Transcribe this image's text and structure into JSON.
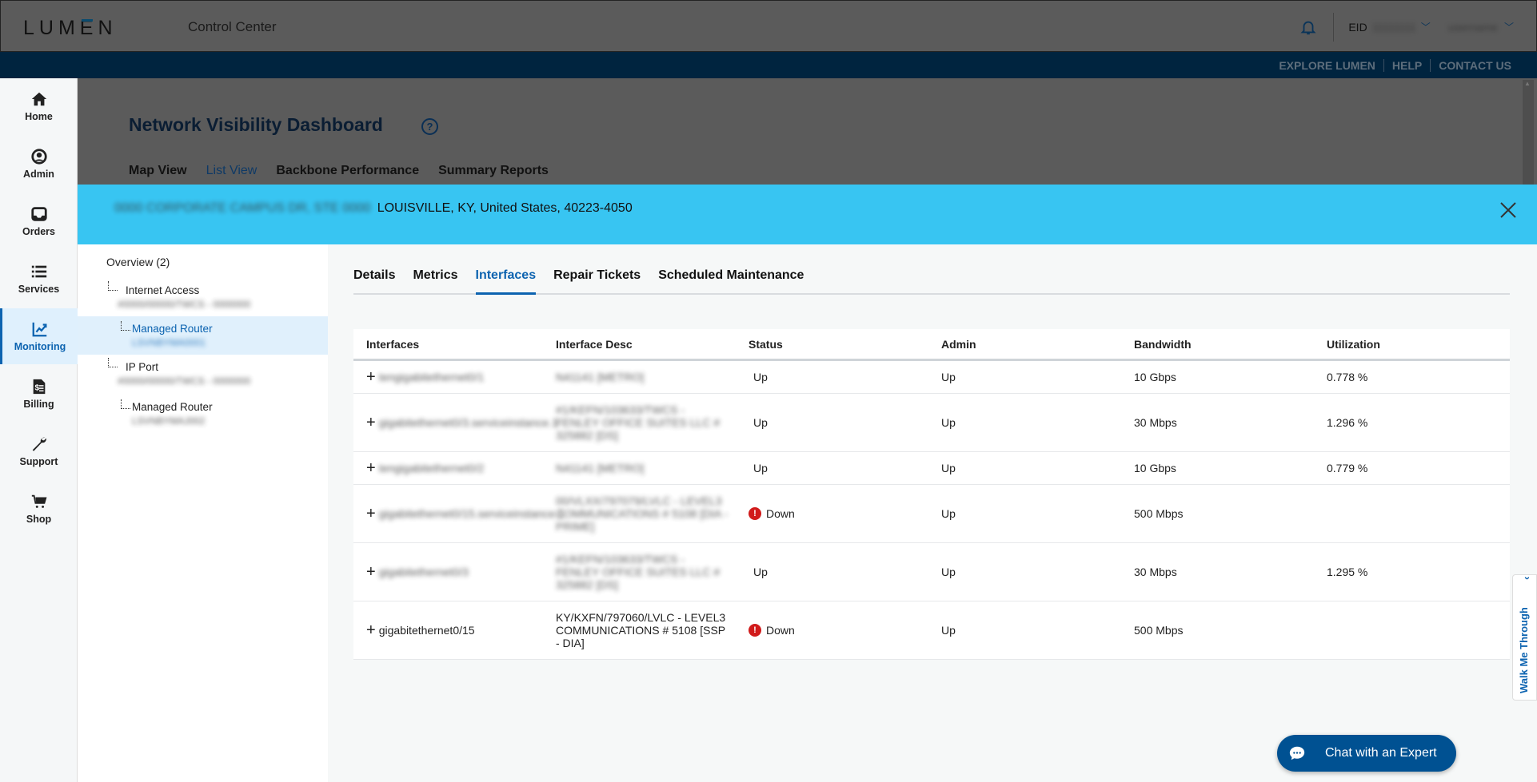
{
  "header": {
    "logo": "LUMEN",
    "app_title": "Control Center",
    "eid_label": "EID",
    "eid_value": "11111111",
    "user_name": "username"
  },
  "navbar": {
    "links": [
      "EXPLORE LUMEN",
      "HELP",
      "CONTACT US"
    ]
  },
  "sidebar": {
    "items": [
      {
        "label": "Home",
        "icon": "home-icon"
      },
      {
        "label": "Admin",
        "icon": "user-circle-icon"
      },
      {
        "label": "Orders",
        "icon": "inbox-icon"
      },
      {
        "label": "Services",
        "icon": "list-icon"
      },
      {
        "label": "Monitoring",
        "icon": "chart-line-icon",
        "active": true
      },
      {
        "label": "Billing",
        "icon": "invoice-icon"
      },
      {
        "label": "Support",
        "icon": "wrench-icon"
      },
      {
        "label": "Shop",
        "icon": "cart-icon"
      }
    ]
  },
  "dashboard": {
    "title": "Network Visibility Dashboard",
    "tabs": [
      "Map View",
      "List View",
      "Backbone Performance",
      "Summary Reports"
    ],
    "selected_tab": "List View"
  },
  "banner": {
    "address_redacted": "0000 CORPORATE CAMPUS DR, STE 0000",
    "address": "LOUISVILLE, KY, United States, 40223-4050"
  },
  "tree": {
    "overview": "Overview (2)",
    "nodes": [
      {
        "label": "Internet Access",
        "sub": "#0000/00000/TWCS - 0000000"
      },
      {
        "label": "Managed Router",
        "sub": "LSVNBYMA0001",
        "selected": true
      },
      {
        "label": "IP Port",
        "sub": "#0000/00000/TWCS - 0000000"
      },
      {
        "label": "Managed Router",
        "sub": "LSVNBYMAJ002"
      }
    ]
  },
  "content": {
    "tabs": [
      "Details",
      "Metrics",
      "Interfaces",
      "Repair Tickets",
      "Scheduled Maintenance"
    ],
    "selected_tab": "Interfaces",
    "table": {
      "headers": [
        "Interfaces",
        "Interface Desc",
        "Status",
        "Admin",
        "Bandwidth",
        "Utilization"
      ],
      "rows": [
        {
          "iface": "tengigabitethernet0/1",
          "iface_redacted": true,
          "desc": "N41141 [METRO]",
          "desc_redacted": true,
          "status": "Up",
          "status_alert": false,
          "admin": "Up",
          "bandwidth": "10 Gbps",
          "utilization": "0.778 %"
        },
        {
          "iface": "gigabitethernet0/3.serviceinstance.1",
          "iface_redacted": true,
          "desc": "#1/KEFN/103633/TWCS - FENLEY OFFICE SUITES LLC # 325882 [DS]",
          "desc_redacted": true,
          "status": "Up",
          "status_alert": false,
          "admin": "Up",
          "bandwidth": "30 Mbps",
          "utilization": "1.296 %"
        },
        {
          "iface": "tengigabitethernet0/2",
          "iface_redacted": true,
          "desc": "N41141 [METRO]",
          "desc_redacted": true,
          "status": "Up",
          "status_alert": false,
          "admin": "Up",
          "bandwidth": "10 Gbps",
          "utilization": "0.779 %"
        },
        {
          "iface": "gigabitethernet0/15.serviceinstance.1",
          "iface_redacted": true,
          "desc": "00/VLXX/797079/LVLC - LEVEL3 COMMUNICATIONS # 5108 [DIA - PRIME]",
          "desc_redacted": true,
          "status": "Down",
          "status_alert": true,
          "admin": "Up",
          "bandwidth": "500 Mbps",
          "utilization": ""
        },
        {
          "iface": "gigabitethernet0/3",
          "iface_redacted": true,
          "desc": "#1/KEFN/103633/TWCS - FENLEY OFFICE SUITES LLC # 325882 [DS]",
          "desc_redacted": true,
          "status": "Up",
          "status_alert": false,
          "admin": "Up",
          "bandwidth": "30 Mbps",
          "utilization": "1.295 %"
        },
        {
          "iface": "gigabitethernet0/15",
          "iface_redacted": false,
          "desc": "KY/KXFN/797060/LVLC - LEVEL3 COMMUNICATIONS # 5108 [SSP - DIA]",
          "desc_redacted": false,
          "status": "Down",
          "status_alert": true,
          "admin": "Up",
          "bandwidth": "500 Mbps",
          "utilization": ""
        }
      ]
    }
  },
  "walkme": {
    "label": "Walk Me Through"
  },
  "chat": {
    "label": "Chat with an Expert"
  },
  "colors": {
    "accent": "#0c63b0",
    "banner": "#38c5f2",
    "navbar": "#00243f",
    "chat_button": "#005192",
    "alert": "#d11b1b"
  }
}
